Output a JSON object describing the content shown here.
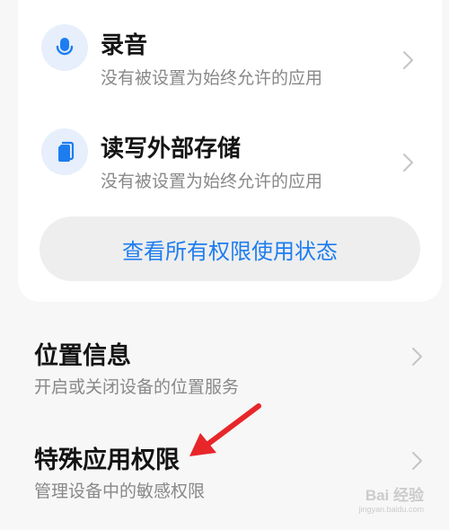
{
  "permissions": {
    "items": [
      {
        "icon": "microphone-icon",
        "title": "录音",
        "subtitle": "没有被设置为始终允许的应用"
      },
      {
        "icon": "storage-icon",
        "title": "读写外部存储",
        "subtitle": "没有被设置为始终允许的应用"
      }
    ],
    "view_all_label": "查看所有权限使用状态"
  },
  "settings": {
    "items": [
      {
        "title": "位置信息",
        "subtitle": "开启或关闭设备的位置服务"
      },
      {
        "title": "特殊应用权限",
        "subtitle": "管理设备中的敏感权限"
      }
    ]
  },
  "watermark": {
    "brand": "Bai 经验",
    "url": "jingyan.baidu.com"
  },
  "colors": {
    "accent": "#1d7df0",
    "icon_bg": "#e6effb",
    "arrow": "#e8262a",
    "subtitle": "#888888",
    "chevron": "#c4c4c4"
  }
}
